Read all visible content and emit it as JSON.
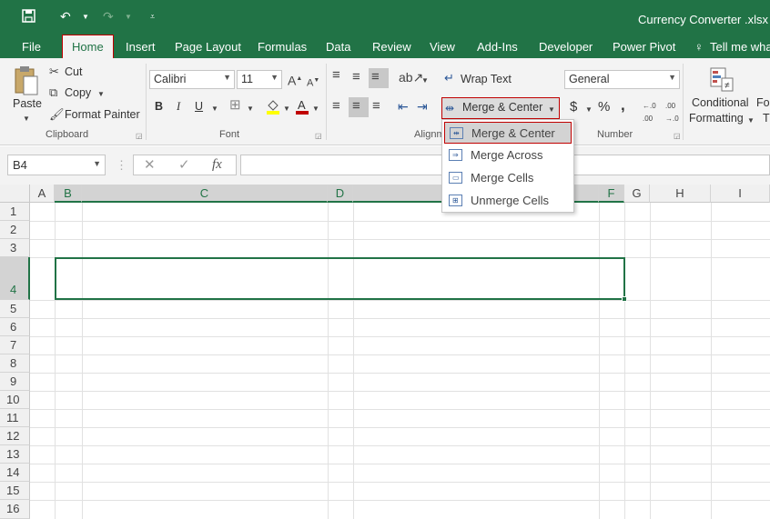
{
  "titlebar": {
    "document_title": "Currency Converter .xlsx"
  },
  "tabs": [
    {
      "label": "File"
    },
    {
      "label": "Home"
    },
    {
      "label": "Insert"
    },
    {
      "label": "Page Layout"
    },
    {
      "label": "Formulas"
    },
    {
      "label": "Data"
    },
    {
      "label": "Review"
    },
    {
      "label": "View"
    },
    {
      "label": "Add-Ins"
    },
    {
      "label": "Developer"
    },
    {
      "label": "Power Pivot"
    },
    {
      "label": "Tell me wha"
    }
  ],
  "ribbon": {
    "clipboard": {
      "paste": "Paste",
      "cut": "Cut",
      "copy": "Copy",
      "format_painter": "Format Painter",
      "label": "Clipboard"
    },
    "font": {
      "name": "Calibri",
      "size": "11",
      "bold": "B",
      "italic": "I",
      "underline": "U",
      "label": "Font"
    },
    "alignment": {
      "wrap_text": "Wrap Text",
      "merge_center": "Merge & Center",
      "label": "Alignm"
    },
    "number": {
      "format": "General",
      "currency": "$",
      "percent": "%",
      "comma": ",",
      "label": "Number"
    },
    "styles": {
      "conditional": "Conditional",
      "formatting": "Formatting",
      "format_as": "Fo",
      "table": "T"
    }
  },
  "formula_bar": {
    "name_box": "B4",
    "fx": "fx",
    "value": ""
  },
  "columns": [
    "A",
    "B",
    "C",
    "D",
    "E",
    "F",
    "G",
    "H",
    "I"
  ],
  "rows": [
    "1",
    "2",
    "3",
    "4",
    "5",
    "6",
    "7",
    "8",
    "9",
    "10",
    "11",
    "12",
    "13",
    "14",
    "15",
    "16"
  ],
  "merge_menu": [
    {
      "label": "Merge & Center"
    },
    {
      "label": "Merge Across"
    },
    {
      "label": "Merge Cells"
    },
    {
      "label": "Unmerge Cells"
    }
  ],
  "colors": {
    "accent": "#217346",
    "highlight_outline": "#c00000"
  }
}
